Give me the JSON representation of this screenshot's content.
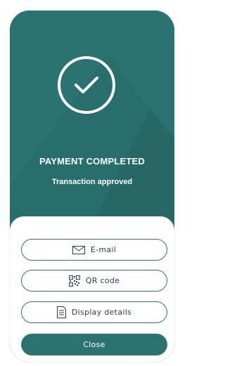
{
  "payment": {
    "title": "PAYMENT COMPLETED",
    "subtitle": "Transaction approved",
    "status_icon": "checkmark-circle-icon"
  },
  "actions": {
    "email_label": "E-mail",
    "email_icon": "envelope-icon",
    "qr_label": "QR code",
    "qr_icon": "qr-code-icon",
    "details_label": "Display details",
    "details_icon": "document-icon",
    "close_label": "Close"
  },
  "colors": {
    "primary": "#2b7371",
    "on_primary": "#ffffff",
    "surface": "#ffffff"
  }
}
